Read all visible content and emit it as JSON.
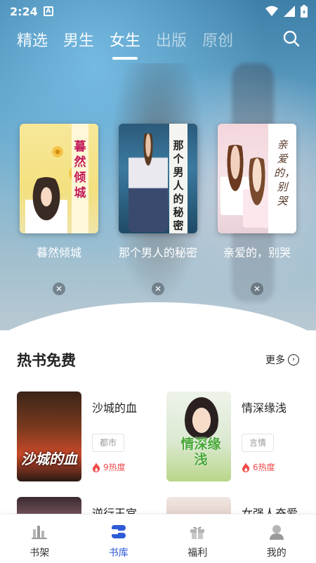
{
  "status_bar": {
    "time": "2:24",
    "notif_icon": "a-notification-icon"
  },
  "top_tabs": [
    {
      "label": "精选",
      "state": "normal"
    },
    {
      "label": "男生",
      "state": "normal"
    },
    {
      "label": "女生",
      "state": "active"
    },
    {
      "label": "出版",
      "state": "dim"
    },
    {
      "label": "原创",
      "state": "dim"
    }
  ],
  "featured": [
    {
      "title": "暮然倾城",
      "cover_text": "暮然倾城"
    },
    {
      "title": "那个男人的秘密",
      "cover_text": "那个男人的秘密"
    },
    {
      "title": "亲爱的，别哭",
      "cover_text": "亲爱的，别哭"
    }
  ],
  "section": {
    "title": "热书免费",
    "more_label": "更多"
  },
  "books": [
    {
      "title": "沙城的血",
      "tag": "都市",
      "heat": "9热度",
      "cover_text": "沙城的血"
    },
    {
      "title": "情深缘浅",
      "tag": "言情",
      "heat": "6热度",
      "cover_text": "情深缘浅"
    },
    {
      "title": "逆行王宫",
      "tag": "",
      "heat": ""
    },
    {
      "title": "女强人奋爱",
      "tag": "",
      "heat": ""
    }
  ],
  "bottom_nav": [
    {
      "label": "书架",
      "icon": "bookshelf-icon"
    },
    {
      "label": "书库",
      "icon": "library-icon",
      "active": true
    },
    {
      "label": "福利",
      "icon": "gift-icon"
    },
    {
      "label": "我的",
      "icon": "profile-icon"
    }
  ],
  "colors": {
    "accent": "#2e5bd6",
    "heat": "#f04a4a",
    "text": "#222222"
  }
}
